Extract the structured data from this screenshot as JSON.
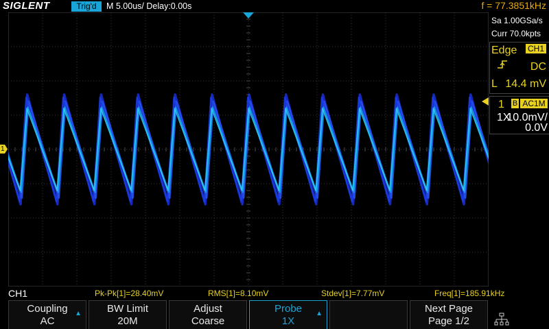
{
  "topbar": {
    "brand": "SIGLENT",
    "trigger_status": "Trig'd",
    "timebase": "M 5.00us/  Delay:0.00s",
    "frequency": "f = 77.3851kHz"
  },
  "acquisition": {
    "sample_rate": "Sa 1.00GSa/s",
    "memory_depth": "Curr 70.0kpts"
  },
  "trigger": {
    "type": "Edge",
    "source": "CH1",
    "slope_icon": "rising-edge-icon",
    "coupling": "DC",
    "level_label": "L",
    "level": "14.4 mV"
  },
  "channel": {
    "number": "1",
    "bw_badge": "B",
    "coupling_impedance": "AC1M",
    "probe": "1X",
    "scale": "10.0mV/",
    "offset": "0.0V",
    "marker_label": "1",
    "color": "#1a6ef0"
  },
  "measurements": {
    "channel_label": "CH1",
    "pkpk": "Pk-Pk[1]=28.40mV",
    "rms": "RMS[1]=8.10mV",
    "stdev": "Stdev[1]=7.77mV",
    "freq": "Freq[1]=185.91kHz"
  },
  "softkeys": [
    {
      "line1": "Coupling",
      "line2": "AC",
      "has_arrow": true
    },
    {
      "line1": "BW Limit",
      "line2": "20M",
      "has_arrow": false
    },
    {
      "line1": "Adjust",
      "line2": "Coarse",
      "has_arrow": false
    },
    {
      "line1": "Probe",
      "line2": "1X",
      "has_arrow": true
    },
    {
      "line1": "",
      "line2": "",
      "has_arrow": false
    },
    {
      "line1": "Next Page",
      "line2": "Page 1/2",
      "has_arrow": false
    }
  ],
  "waveform": {
    "type": "sawtooth",
    "cycles": 13,
    "high_divs": 1.6,
    "low_divs": -1.6
  },
  "colors": {
    "accent": "#1aa5d8",
    "measurement": "#e8d21f",
    "frequency": "#e6a91a",
    "grid": "#4a4a4a"
  }
}
